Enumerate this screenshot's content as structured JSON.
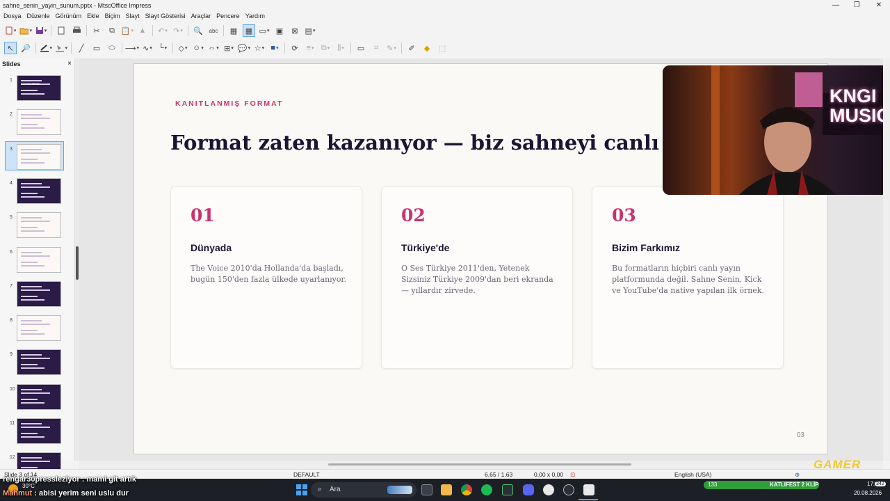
{
  "window": {
    "title": "sahne_senin_yayin_sunum.pptx - MtscOffice Impress",
    "minimize": "—",
    "restore": "❐",
    "close": "✕"
  },
  "menu": [
    "Dosya",
    "Düzenle",
    "Görünüm",
    "Ekle",
    "Biçim",
    "Slayt",
    "Slayt Gösterisi",
    "Araçlar",
    "Pencere",
    "Yardım"
  ],
  "slides_pane": {
    "header": "Slides",
    "close": "×",
    "thumbnails": [
      {
        "num": "1",
        "theme": "dark",
        "title": "SAHNE SENİN"
      },
      {
        "num": "2",
        "theme": "light"
      },
      {
        "num": "3",
        "theme": "light",
        "selected": true
      },
      {
        "num": "4",
        "theme": "dark"
      },
      {
        "num": "5",
        "theme": "light"
      },
      {
        "num": "6",
        "theme": "light"
      },
      {
        "num": "7",
        "theme": "dark"
      },
      {
        "num": "8",
        "theme": "light"
      },
      {
        "num": "9",
        "theme": "dark"
      },
      {
        "num": "10",
        "theme": "dark"
      },
      {
        "num": "11",
        "theme": "dark"
      },
      {
        "num": "12",
        "theme": "dark"
      }
    ]
  },
  "slide": {
    "eyebrow": "KANITLANMIŞ FORMAT",
    "headline": "Format zaten kazanıyor — biz sahneyi canlı yayına",
    "cards": [
      {
        "num": "01",
        "title": "Dünyada",
        "body": "The Voice 2010'da Hollanda'da başladı, bugün 150'den fazla ülkede uyarlanıyor."
      },
      {
        "num": "02",
        "title": "Türkiye'de",
        "body": "O Ses Türkiye 2011'den, Yetenek Sizsiniz Türkiye 2009'dan beri ekranda — yıllardır zirvede."
      },
      {
        "num": "03",
        "title": "Bizim Farkımız",
        "body": "Bu formatların hiçbiri canlı yayın platformunda değil. Sahne Senin, Kick ve YouTube'da native yapılan ilk örnek."
      }
    ],
    "page_number": "03"
  },
  "webcam": {
    "sign_text": "KNGI MUSIC"
  },
  "statusbar": {
    "slide_info": "Slide 3 of 14",
    "layout": "DEFAULT",
    "position": "6,65 / 1,63",
    "size": "0,00 x 0,00",
    "language": "English (USA)"
  },
  "chat": [
    {
      "user": "rengar30pressleziyor",
      "message": "mami git artık"
    },
    {
      "user": "Mahmut",
      "message": "abisi yerim seni uslu dur"
    }
  ],
  "weather": {
    "temp": "30°C"
  },
  "taskbar": {
    "search_placeholder": "Ara",
    "tray_badge": "133",
    "tray_label": "KATLIFEST 2 KLİP",
    "clock_time": "17:42",
    "clock_date": "20.08.2026",
    "notif_count": "342"
  },
  "overlay_brand": "GAMER"
}
